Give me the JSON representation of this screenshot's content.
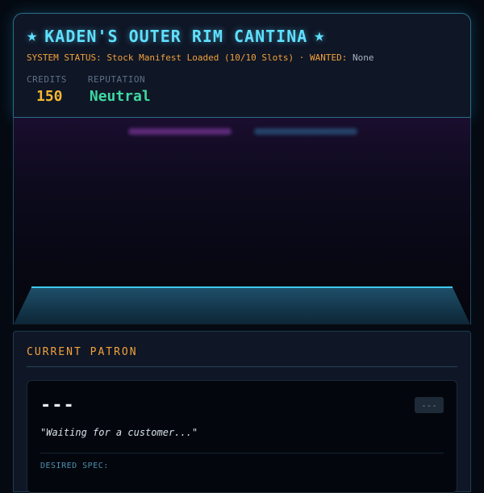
{
  "header": {
    "title": "KADEN'S OUTER RIM CANTINA",
    "title_icon": "star-icon",
    "status_label": "SYSTEM STATUS:",
    "status_text": "Stock Manifest Loaded (10/10 Slots)",
    "separator": "·",
    "wanted_label": "WANTED:",
    "wanted_value": "None",
    "credits_label": "CREDITS",
    "credits_value": "150",
    "reputation_label": "REPUTATION",
    "reputation_value": "Neutral"
  },
  "patron": {
    "section_title": "CURRENT PATRON",
    "name": "---",
    "tag": "---",
    "quote": "\"Waiting for a customer...\"",
    "spec_label": "DESIRED SPEC:"
  },
  "colors": {
    "accent_cyan": "#5fe0ff",
    "accent_orange": "#f2a23a",
    "credits_gold": "#f5b733",
    "reputation_green": "#3fd8a0"
  }
}
